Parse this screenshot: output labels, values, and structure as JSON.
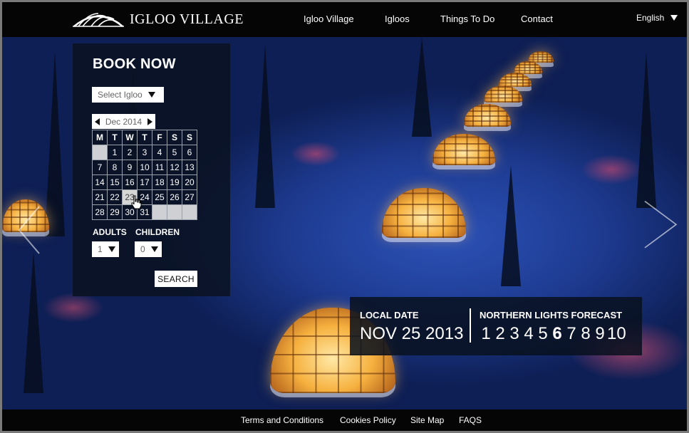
{
  "header": {
    "logo_text": "IGLOO VILLAGE",
    "nav": [
      {
        "label": "Igloo Village"
      },
      {
        "label": "Igloos"
      },
      {
        "label": "Things To Do"
      },
      {
        "label": "Contact"
      }
    ],
    "language": "English"
  },
  "booking": {
    "title": "BOOK NOW",
    "igloo_select": "Select Igloo",
    "month_label": "Dec 2014",
    "weekdays": [
      "M",
      "T",
      "W",
      "T",
      "F",
      "S",
      "S"
    ],
    "weeks": [
      [
        "",
        "1",
        "2",
        "3",
        "4",
        "5",
        "6"
      ],
      [
        "7",
        "8",
        "9",
        "10",
        "11",
        "12",
        "13"
      ],
      [
        "14",
        "15",
        "16",
        "17",
        "18",
        "19",
        "20"
      ],
      [
        "21",
        "22",
        "23",
        "24",
        "25",
        "26",
        "27"
      ],
      [
        "28",
        "29",
        "30",
        "31",
        "",
        "",
        ""
      ]
    ],
    "selected_day": "23",
    "adults_label": "ADULTS",
    "adults_value": "1",
    "children_label": "CHILDREN",
    "children_value": "0",
    "search_label": "SEARCH"
  },
  "info": {
    "local_date_label": "LOCAL DATE",
    "local_date_value": "NOV 25 2013",
    "forecast_label": "NORTHERN LIGHTS FORECAST",
    "forecast_scale": [
      "1",
      "2",
      "3",
      "4",
      "5",
      "6",
      "7",
      "8",
      "9",
      "10"
    ],
    "forecast_current": "6"
  },
  "footer": {
    "links": [
      {
        "label": "Terms and Conditions"
      },
      {
        "label": "Cookies Policy"
      },
      {
        "label": "Site Map"
      },
      {
        "label": "FAQS"
      }
    ]
  },
  "icons": {
    "logo": "igloo-dome-logo",
    "prev": "chevron-left-icon",
    "next": "chevron-right-icon",
    "cursor": "hand-pointer-icon"
  }
}
